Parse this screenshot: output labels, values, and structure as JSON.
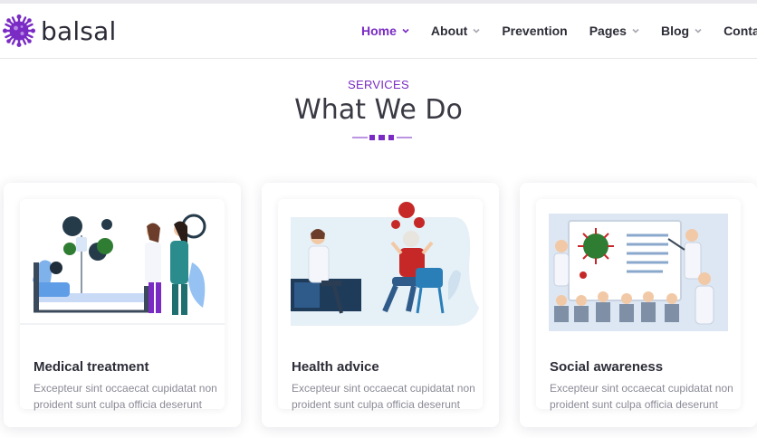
{
  "brand": {
    "name": "balsal"
  },
  "nav": [
    {
      "label": "Home",
      "has_dropdown": true,
      "active": true
    },
    {
      "label": "About",
      "has_dropdown": true,
      "active": false
    },
    {
      "label": "Prevention",
      "has_dropdown": false,
      "active": false
    },
    {
      "label": "Pages",
      "has_dropdown": true,
      "active": false
    },
    {
      "label": "Blog",
      "has_dropdown": true,
      "active": false
    },
    {
      "label": "Contact",
      "has_dropdown": false,
      "active": false
    }
  ],
  "section": {
    "eyebrow": "SERVICES",
    "title": "What We Do"
  },
  "cards": [
    {
      "title": "Medical treatment",
      "text": "Excepteur sint occaecat cupidatat non proident sunt culpa officia deserunt",
      "illustration": "medical-treatment-illustration"
    },
    {
      "title": "Health advice",
      "text": "Excepteur sint occaecat cupidatat non proident sunt culpa officia deserunt",
      "illustration": "health-advice-illustration"
    },
    {
      "title": "Social awareness",
      "text": "Excepteur sint occaecat cupidatat non proident sunt culpa officia deserunt",
      "illustration": "social-awareness-illustration"
    }
  ],
  "colors": {
    "accent": "#7a2bc4",
    "heading": "#3a3a44",
    "text": "#8a8a96",
    "virus_red": "#c62828",
    "virus_green": "#2e7d32",
    "virus_navy": "#1f3b4d"
  }
}
